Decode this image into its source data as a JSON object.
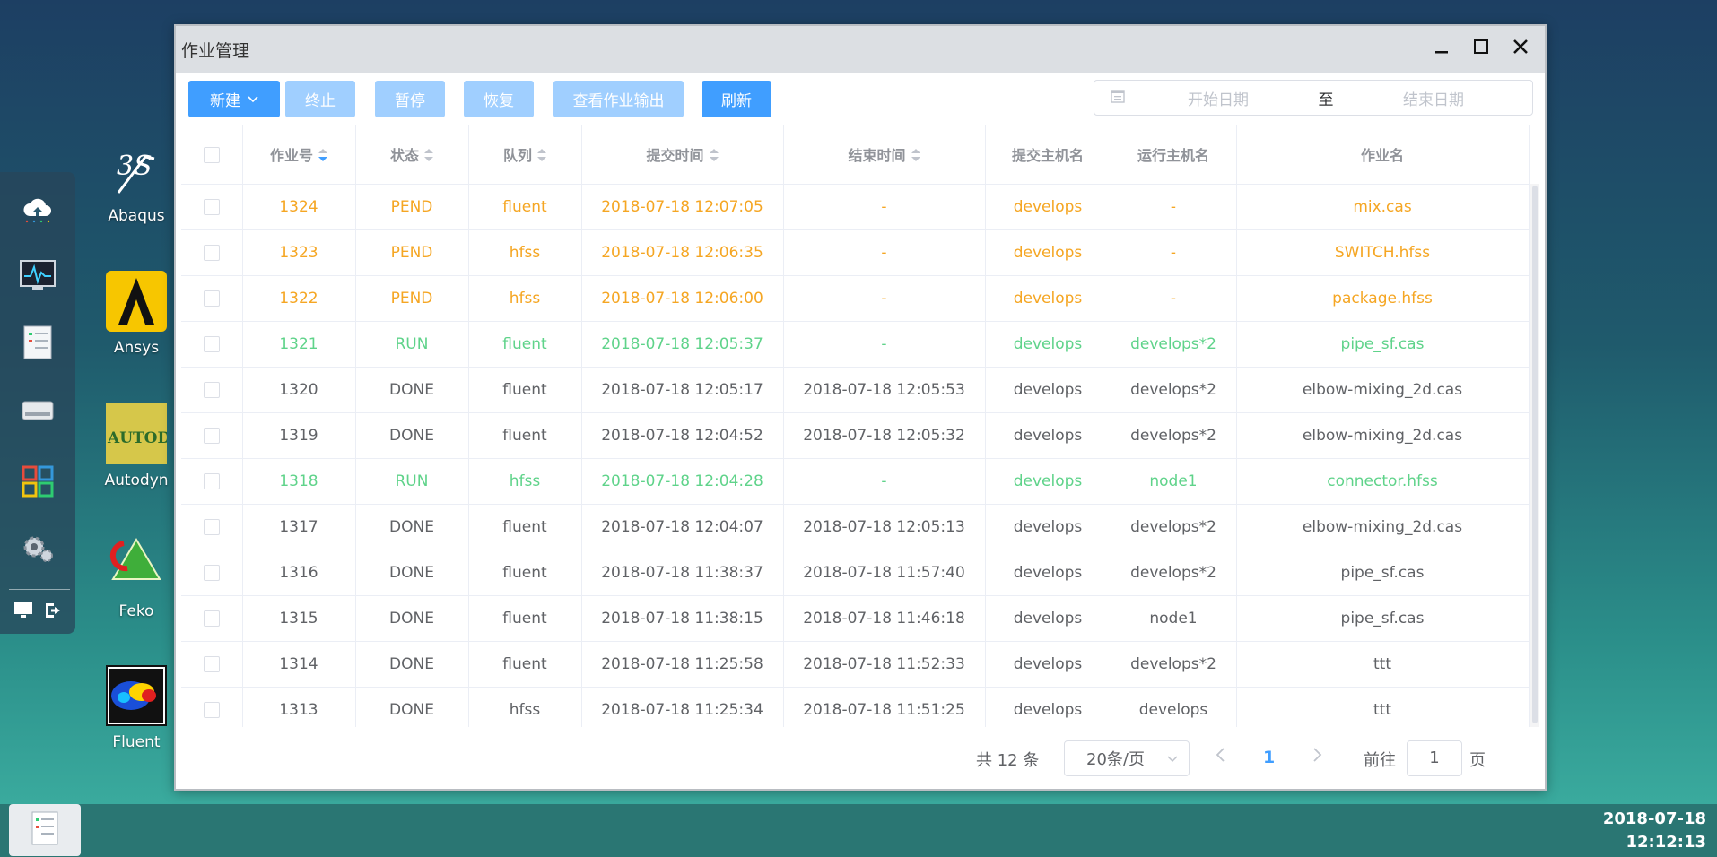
{
  "dock": {
    "icons": [
      "cloud-upload-icon",
      "monitor-chart-icon",
      "document-list-icon",
      "drive-icon",
      "app-grid-icon",
      "gear-icon"
    ],
    "bottom_icons": [
      "desktop-icon",
      "logout-icon"
    ]
  },
  "desktop": {
    "icons": [
      {
        "label": "Abaqus",
        "icon": "abaqus-logo"
      },
      {
        "label": "Ansys",
        "icon": "ansys-logo"
      },
      {
        "label": "Autodyn",
        "icon": "autodyn-logo"
      },
      {
        "label": "Feko",
        "icon": "feko-logo"
      },
      {
        "label": "Fluent",
        "icon": "fluent-logo"
      }
    ]
  },
  "window": {
    "title": "作业管理",
    "controls": [
      "minimize-icon",
      "maximize-icon",
      "close-icon"
    ]
  },
  "toolbar": {
    "new_label": "新建",
    "terminate_label": "终止",
    "pause_label": "暂停",
    "resume_label": "恢复",
    "view_output_label": "查看作业输出",
    "refresh_label": "刷新",
    "start_date_placeholder": "开始日期",
    "range_separator": "至",
    "end_date_placeholder": "结束日期"
  },
  "colors": {
    "primary": "#409eff",
    "pending": "#f5a623",
    "running": "#5fd38a",
    "done": "#606266"
  },
  "table": {
    "headers": [
      "作业号",
      "状态",
      "队列",
      "提交时间",
      "结束时间",
      "提交主机名",
      "运行主机名",
      "作业名"
    ],
    "rows": [
      {
        "status_class": "pend",
        "cells": [
          "1324",
          "PEND",
          "fluent",
          "2018-07-18 12:07:05",
          "-",
          "develops",
          "-",
          "mix.cas"
        ]
      },
      {
        "status_class": "pend",
        "cells": [
          "1323",
          "PEND",
          "hfss",
          "2018-07-18 12:06:35",
          "-",
          "develops",
          "-",
          "SWITCH.hfss"
        ]
      },
      {
        "status_class": "pend",
        "cells": [
          "1322",
          "PEND",
          "hfss",
          "2018-07-18 12:06:00",
          "-",
          "develops",
          "-",
          "package.hfss"
        ]
      },
      {
        "status_class": "run",
        "cells": [
          "1321",
          "RUN",
          "fluent",
          "2018-07-18 12:05:37",
          "-",
          "develops",
          "develops*2",
          "pipe_sf.cas"
        ]
      },
      {
        "status_class": "done",
        "cells": [
          "1320",
          "DONE",
          "fluent",
          "2018-07-18 12:05:17",
          "2018-07-18 12:05:53",
          "develops",
          "develops*2",
          "elbow-mixing_2d.cas"
        ]
      },
      {
        "status_class": "done",
        "cells": [
          "1319",
          "DONE",
          "fluent",
          "2018-07-18 12:04:52",
          "2018-07-18 12:05:32",
          "develops",
          "develops*2",
          "elbow-mixing_2d.cas"
        ]
      },
      {
        "status_class": "run",
        "cells": [
          "1318",
          "RUN",
          "hfss",
          "2018-07-18 12:04:28",
          "-",
          "develops",
          "node1",
          "connector.hfss"
        ]
      },
      {
        "status_class": "done",
        "cells": [
          "1317",
          "DONE",
          "fluent",
          "2018-07-18 12:04:07",
          "2018-07-18 12:05:13",
          "develops",
          "develops*2",
          "elbow-mixing_2d.cas"
        ]
      },
      {
        "status_class": "done",
        "cells": [
          "1316",
          "DONE",
          "fluent",
          "2018-07-18 11:38:37",
          "2018-07-18 11:57:40",
          "develops",
          "develops*2",
          "pipe_sf.cas"
        ]
      },
      {
        "status_class": "done",
        "cells": [
          "1315",
          "DONE",
          "fluent",
          "2018-07-18 11:38:15",
          "2018-07-18 11:46:18",
          "develops",
          "node1",
          "pipe_sf.cas"
        ]
      },
      {
        "status_class": "done",
        "cells": [
          "1314",
          "DONE",
          "fluent",
          "2018-07-18 11:25:58",
          "2018-07-18 11:52:33",
          "develops",
          "develops*2",
          "ttt"
        ]
      },
      {
        "status_class": "done",
        "cells": [
          "1313",
          "DONE",
          "hfss",
          "2018-07-18 11:25:34",
          "2018-07-18 11:51:25",
          "develops",
          "develops",
          "ttt"
        ]
      }
    ]
  },
  "pagination": {
    "total_text": "共 12 条",
    "page_size": "20条/页",
    "current_page": "1",
    "goto_label": "前往",
    "goto_value": "1",
    "page_unit": "页"
  },
  "taskbar": {
    "date": "2018-07-18",
    "time": "12:12:13"
  }
}
